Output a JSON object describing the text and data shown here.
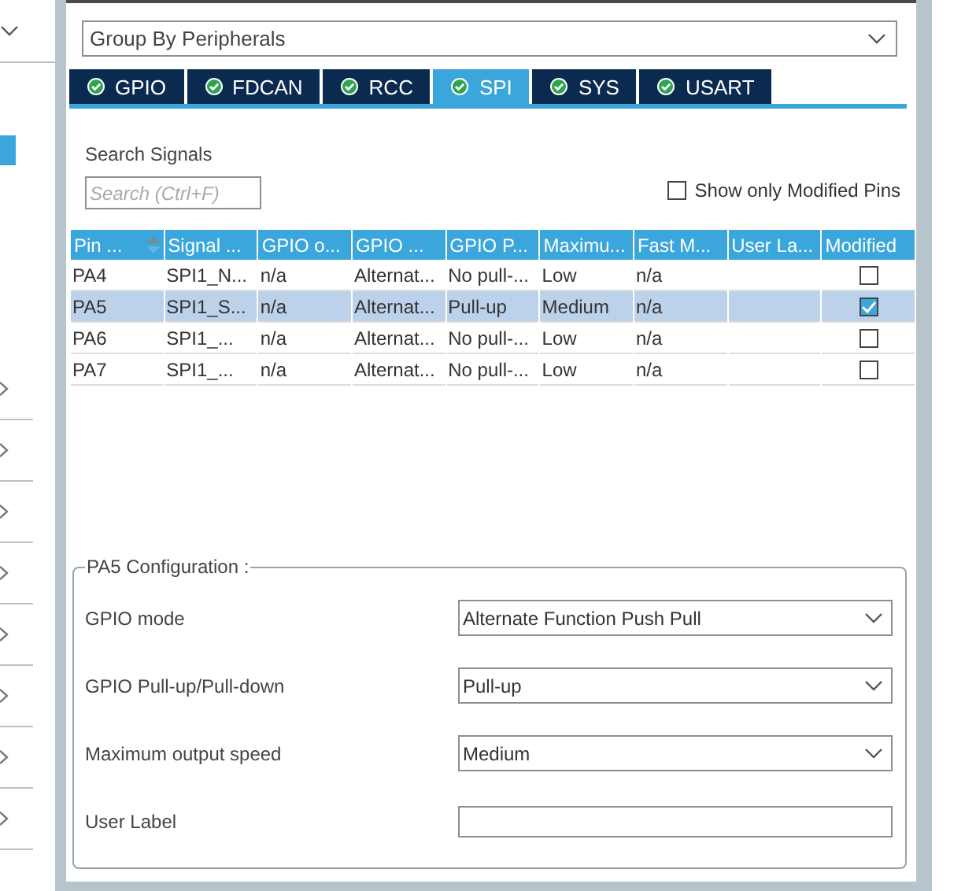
{
  "group_by": {
    "value": "Group By Peripherals"
  },
  "tabs": [
    {
      "label": "GPIO",
      "selected": false
    },
    {
      "label": "FDCAN",
      "selected": false
    },
    {
      "label": "RCC",
      "selected": false
    },
    {
      "label": "SPI",
      "selected": true
    },
    {
      "label": "SYS",
      "selected": false
    },
    {
      "label": "USART",
      "selected": false
    }
  ],
  "search": {
    "label": "Search Signals",
    "placeholder": "Search (Ctrl+F)"
  },
  "show_only_modified": {
    "label": "Show only Modified Pins",
    "checked": false
  },
  "table": {
    "columns": [
      "Pin ...",
      "Signal ...",
      "GPIO o...",
      "GPIO ...",
      "GPIO P...",
      "Maximu...",
      "Fast M...",
      "User La...",
      "Modified"
    ],
    "rows": [
      {
        "cells": [
          "PA4",
          "SPI1_N...",
          "n/a",
          "Alternat...",
          "No pull-...",
          "Low",
          "n/a",
          ""
        ],
        "modified": false,
        "selected": false
      },
      {
        "cells": [
          "PA5",
          "SPI1_S...",
          "n/a",
          "Alternat...",
          "Pull-up",
          "Medium",
          "n/a",
          ""
        ],
        "modified": true,
        "selected": true
      },
      {
        "cells": [
          "PA6",
          "SPI1_...",
          "n/a",
          "Alternat...",
          "No pull-...",
          "Low",
          "n/a",
          ""
        ],
        "modified": false,
        "selected": false
      },
      {
        "cells": [
          "PA7",
          "SPI1_...",
          "n/a",
          "Alternat...",
          "No pull-...",
          "Low",
          "n/a",
          ""
        ],
        "modified": false,
        "selected": false
      }
    ]
  },
  "config": {
    "title": "PA5 Configuration :",
    "fields": [
      {
        "label": "GPIO mode",
        "kind": "select",
        "value": "Alternate Function Push Pull"
      },
      {
        "label": "GPIO Pull-up/Pull-down",
        "kind": "select",
        "value": "Pull-up"
      },
      {
        "label": "Maximum output speed",
        "kind": "select",
        "value": "Medium"
      },
      {
        "label": "User Label",
        "kind": "text"
      }
    ]
  }
}
